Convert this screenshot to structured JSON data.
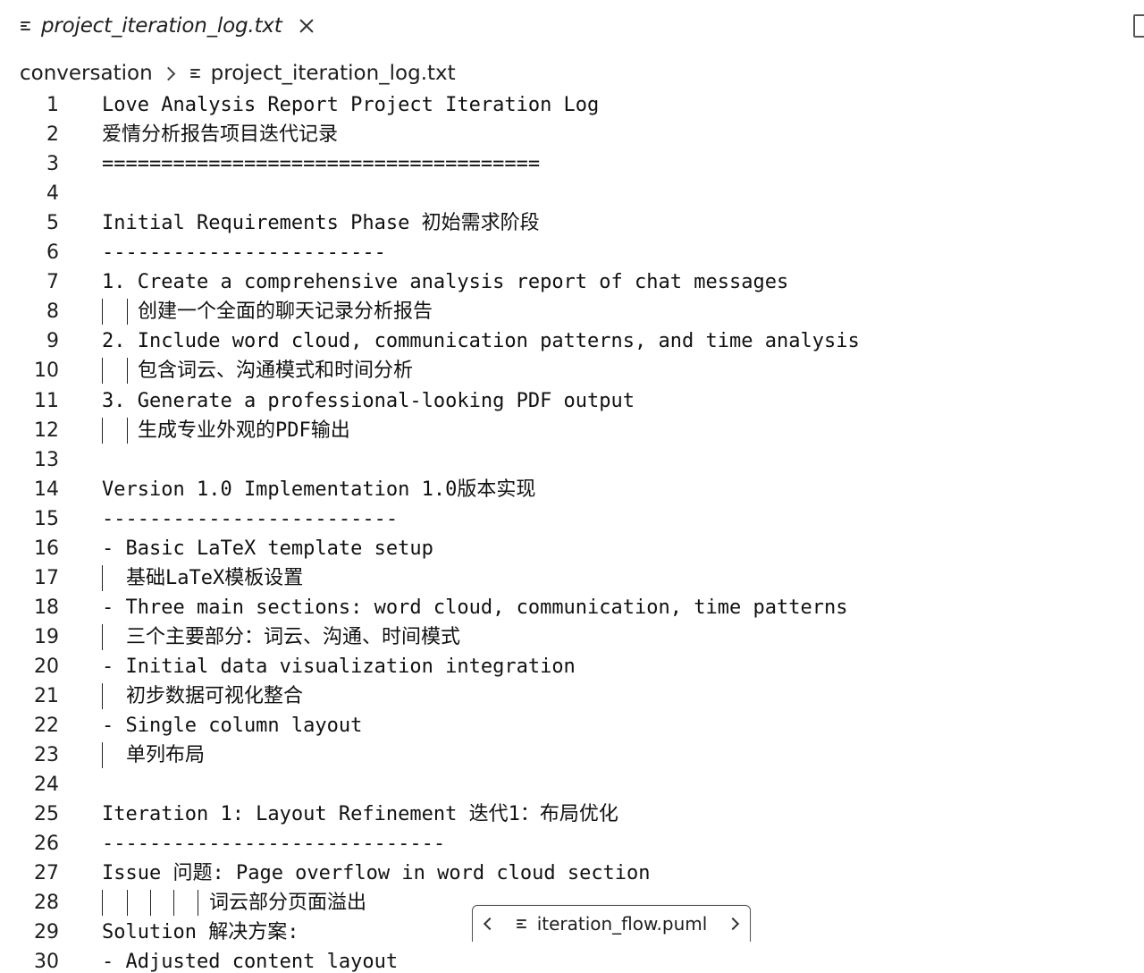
{
  "tab": {
    "label": "project_iteration_log.txt",
    "icon": "file-lines-icon",
    "close_icon": "close-icon"
  },
  "breadcrumb": {
    "folder": "conversation",
    "file": "project_iteration_log.txt"
  },
  "editor": {
    "lines": [
      {
        "n": "1",
        "text": "Love Analysis Report Project Iteration Log"
      },
      {
        "n": "2",
        "text": "爱情分析报告项目迭代记录"
      },
      {
        "n": "3",
        "text": "====================================="
      },
      {
        "n": "4",
        "text": ""
      },
      {
        "n": "5",
        "text": "Initial Requirements Phase 初始需求阶段"
      },
      {
        "n": "6",
        "text": "------------------------"
      },
      {
        "n": "7",
        "text": "1. Create a comprehensive analysis report of chat messages"
      },
      {
        "n": "8",
        "text": "创建一个全面的聊天记录分析报告"
      },
      {
        "n": "9",
        "text": "2. Include word cloud, communication patterns, and time analysis"
      },
      {
        "n": "10",
        "text": "包含词云、沟通模式和时间分析"
      },
      {
        "n": "11",
        "text": "3. Generate a professional-looking PDF output"
      },
      {
        "n": "12",
        "text": "生成专业外观的PDF输出"
      },
      {
        "n": "13",
        "text": ""
      },
      {
        "n": "14",
        "text": "Version 1.0 Implementation 1.0版本实现"
      },
      {
        "n": "15",
        "text": "-------------------------"
      },
      {
        "n": "16",
        "text": "- Basic LaTeX template setup"
      },
      {
        "n": "17",
        "text": "基础LaTeX模板设置"
      },
      {
        "n": "18",
        "text": "- Three main sections: word cloud, communication, time patterns"
      },
      {
        "n": "19",
        "text": "三个主要部分：词云、沟通、时间模式"
      },
      {
        "n": "20",
        "text": "- Initial data visualization integration"
      },
      {
        "n": "21",
        "text": "初步数据可视化整合"
      },
      {
        "n": "22",
        "text": "- Single column layout"
      },
      {
        "n": "23",
        "text": "单列布局"
      },
      {
        "n": "24",
        "text": ""
      },
      {
        "n": "25",
        "text": "Iteration 1: Layout Refinement 迭代1：布局优化"
      },
      {
        "n": "26",
        "text": "-----------------------------"
      },
      {
        "n": "27",
        "text": "Issue 问题: Page overflow in word cloud section"
      },
      {
        "n": "28",
        "text": "词云部分页面溢出"
      },
      {
        "n": "29",
        "text": "Solution 解决方案:"
      },
      {
        "n": "30",
        "text": "- Adjusted content layout"
      }
    ]
  },
  "float_nav": {
    "file": "iteration_flow.puml"
  }
}
